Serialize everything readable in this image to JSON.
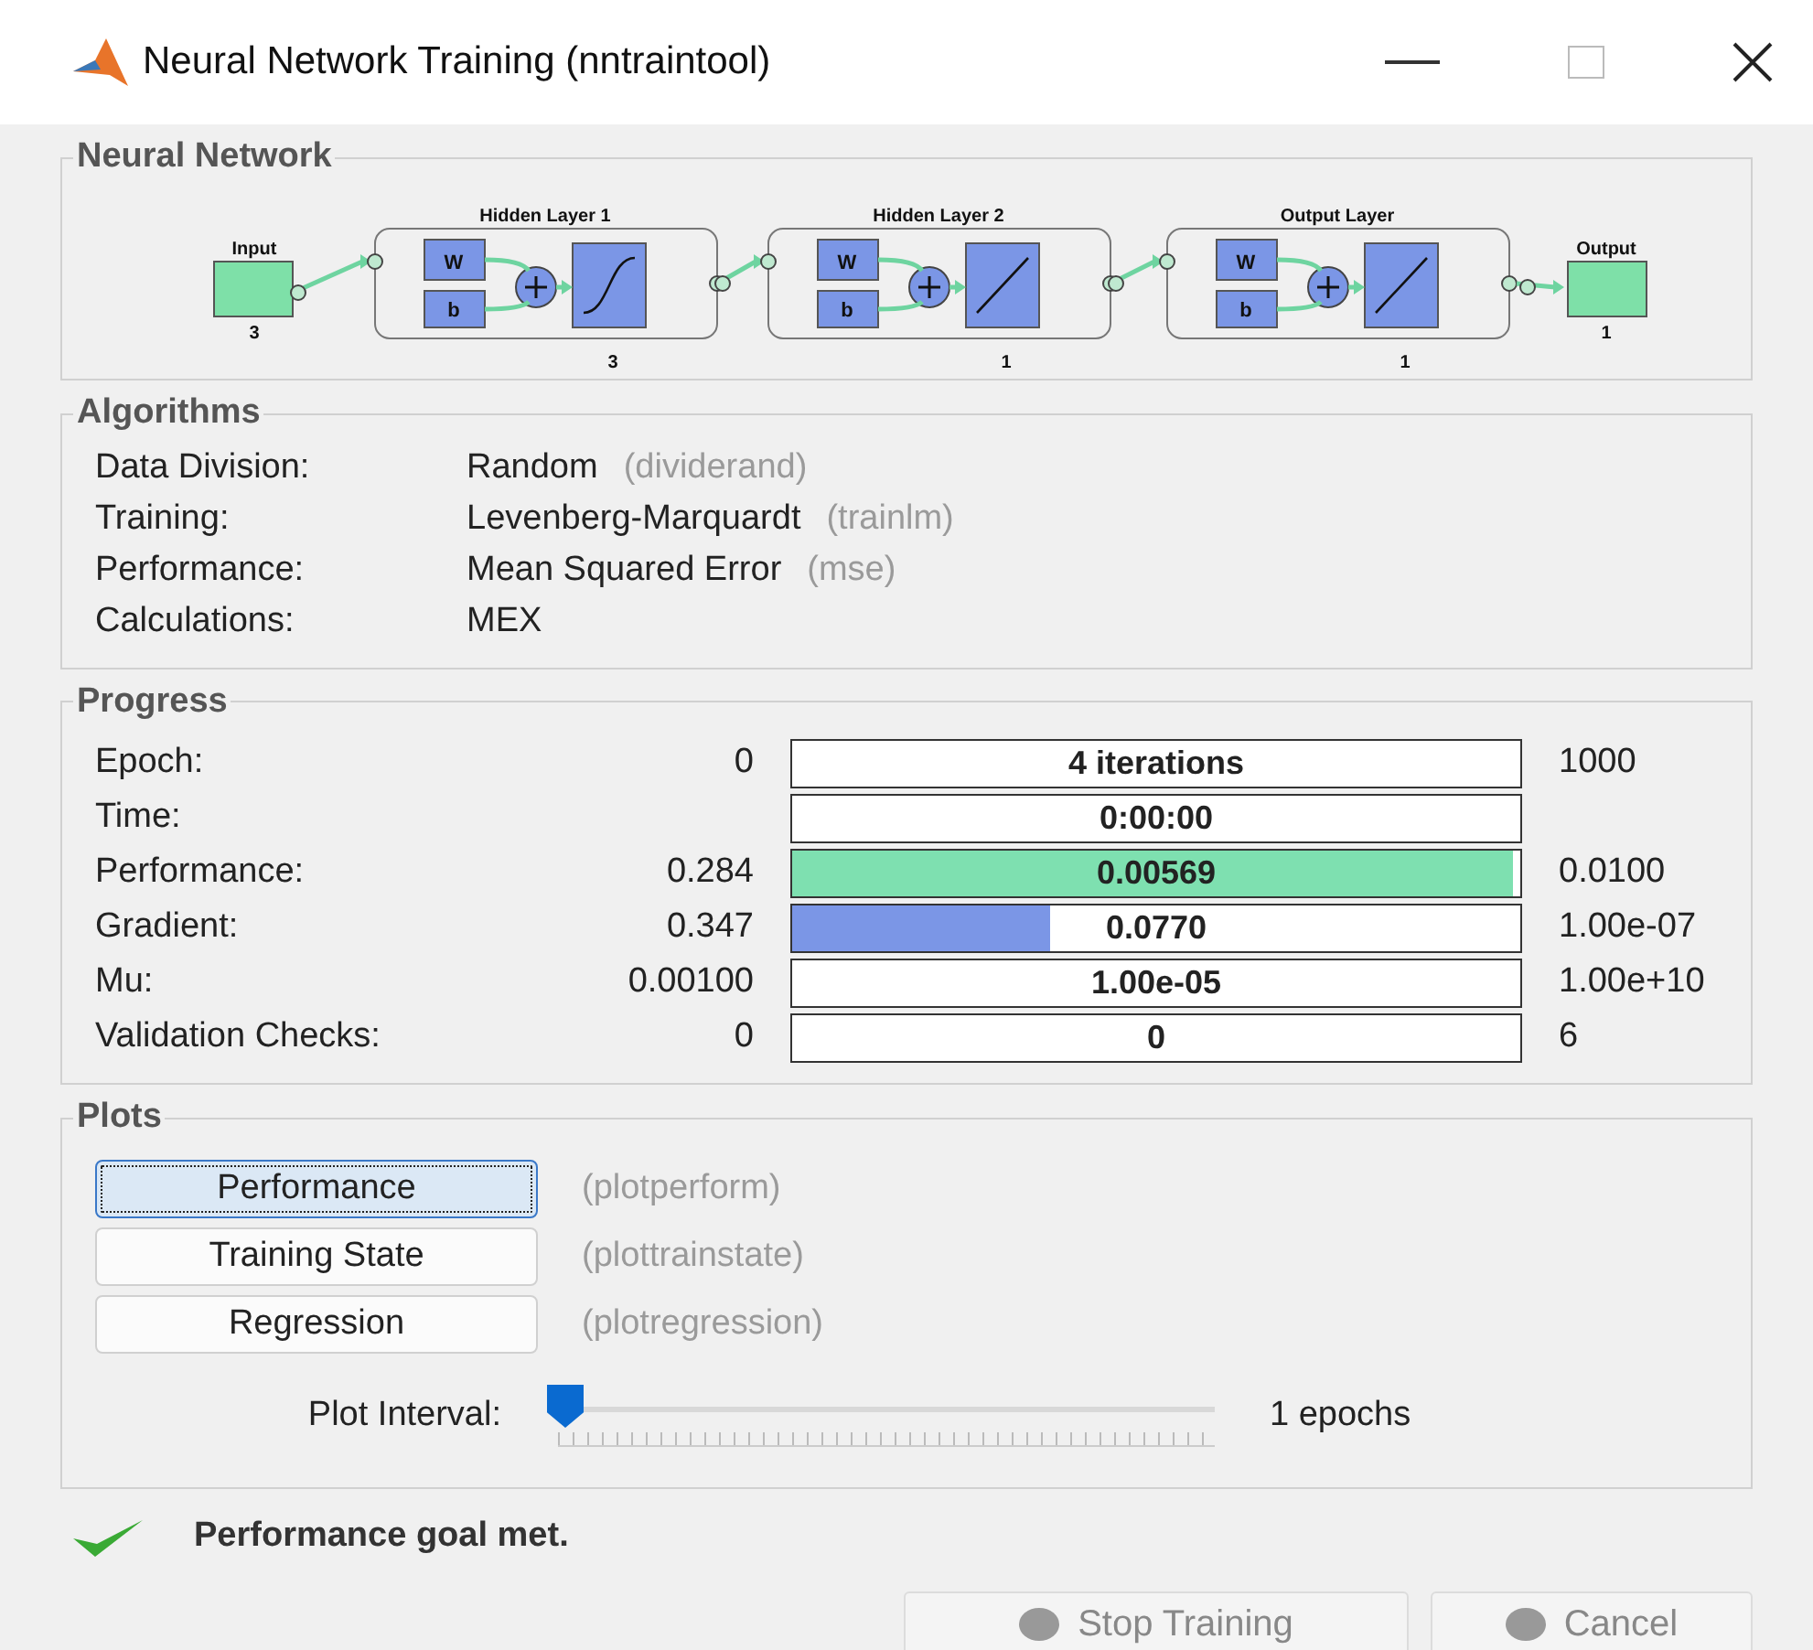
{
  "window": {
    "title": "Neural Network Training (nntraintool)"
  },
  "network": {
    "title": "Neural Network",
    "input": {
      "label": "Input",
      "size": "3"
    },
    "layers": [
      {
        "title": "Hidden Layer 1",
        "weight": "W",
        "bias": "b",
        "size": "3",
        "kind": "sigmoid"
      },
      {
        "title": "Hidden Layer 2",
        "weight": "W",
        "bias": "b",
        "size": "1",
        "kind": "linear"
      },
      {
        "title": "Output Layer",
        "weight": "W",
        "bias": "b",
        "size": "1",
        "kind": "linear"
      }
    ],
    "output": {
      "label": "Output",
      "size": "1"
    }
  },
  "algorithms": {
    "title": "Algorithms",
    "rows": [
      {
        "label": "Data Division:",
        "value": "Random",
        "function": "(dividerand)"
      },
      {
        "label": "Training:",
        "value": "Levenberg-Marquardt",
        "function": "(trainlm)"
      },
      {
        "label": "Performance:",
        "value": "Mean Squared Error",
        "function": "(mse)"
      },
      {
        "label": "Calculations:",
        "value": "MEX"
      }
    ]
  },
  "progress": {
    "title": "Progress",
    "rows": [
      {
        "label": "Epoch:",
        "start": "0",
        "value": "4 iterations",
        "end": "1000",
        "level": 0
      },
      {
        "label": "Time:",
        "value": "0:00:00",
        "level": 0
      },
      {
        "label": "Performance:",
        "start": "0.284",
        "value": "0.00569",
        "end": "0.0100",
        "level": 0.99,
        "color": "#7ee0b0"
      },
      {
        "label": "Gradient:",
        "start": "0.347",
        "value": "0.0770",
        "end": "1.00e-07",
        "level": 0.355,
        "color": "#7b96e6"
      },
      {
        "label": "Mu:",
        "start": "0.00100",
        "value": "1.00e-05",
        "end": "1.00e+10",
        "level": 0
      },
      {
        "label": "Validation Checks:",
        "start": "0",
        "value": "0",
        "end": "6",
        "level": 0
      }
    ]
  },
  "plots": {
    "title": "Plots",
    "buttons": [
      {
        "label": "Performance",
        "function": "(plotperform)",
        "selected": true
      },
      {
        "label": "Training State",
        "function": "(plottrainstate)",
        "selected": false
      },
      {
        "label": "Regression",
        "function": "(plotregression)",
        "selected": false
      }
    ],
    "interval": {
      "label": "Plot Interval:",
      "level": 0,
      "value": "1 epochs"
    }
  },
  "status": {
    "text": "Performance goal met.",
    "ok": true
  },
  "buttons": [
    {
      "label": "Stop Training",
      "disabled": true
    },
    {
      "label": "Cancel",
      "disabled": true
    }
  ]
}
